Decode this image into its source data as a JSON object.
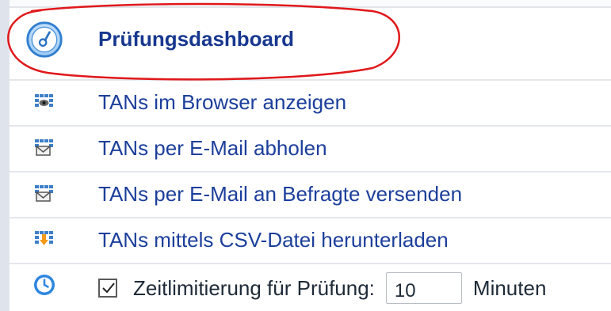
{
  "menu": {
    "dashboard": {
      "label": "Prüfungsdashboard",
      "icon": "speedometer-icon"
    },
    "items": [
      {
        "label": "TANs im Browser anzeigen",
        "icon": "tan-view-icon"
      },
      {
        "label": "TANs per E-Mail abholen",
        "icon": "tan-mail-icon"
      },
      {
        "label": "TANs per E-Mail an Befragte versenden",
        "icon": "tan-send-icon"
      },
      {
        "label": "TANs mittels CSV-Datei herunterladen",
        "icon": "tan-download-icon"
      }
    ],
    "timelimit": {
      "icon": "clock-icon",
      "checked": true,
      "label": "Zeitlimitierung für Prüfung:",
      "value": "10",
      "unit": "Minuten"
    }
  },
  "colors": {
    "link": "#1c3f9b",
    "highlight": "#e0181b",
    "icon_blue": "#3a86d4"
  }
}
